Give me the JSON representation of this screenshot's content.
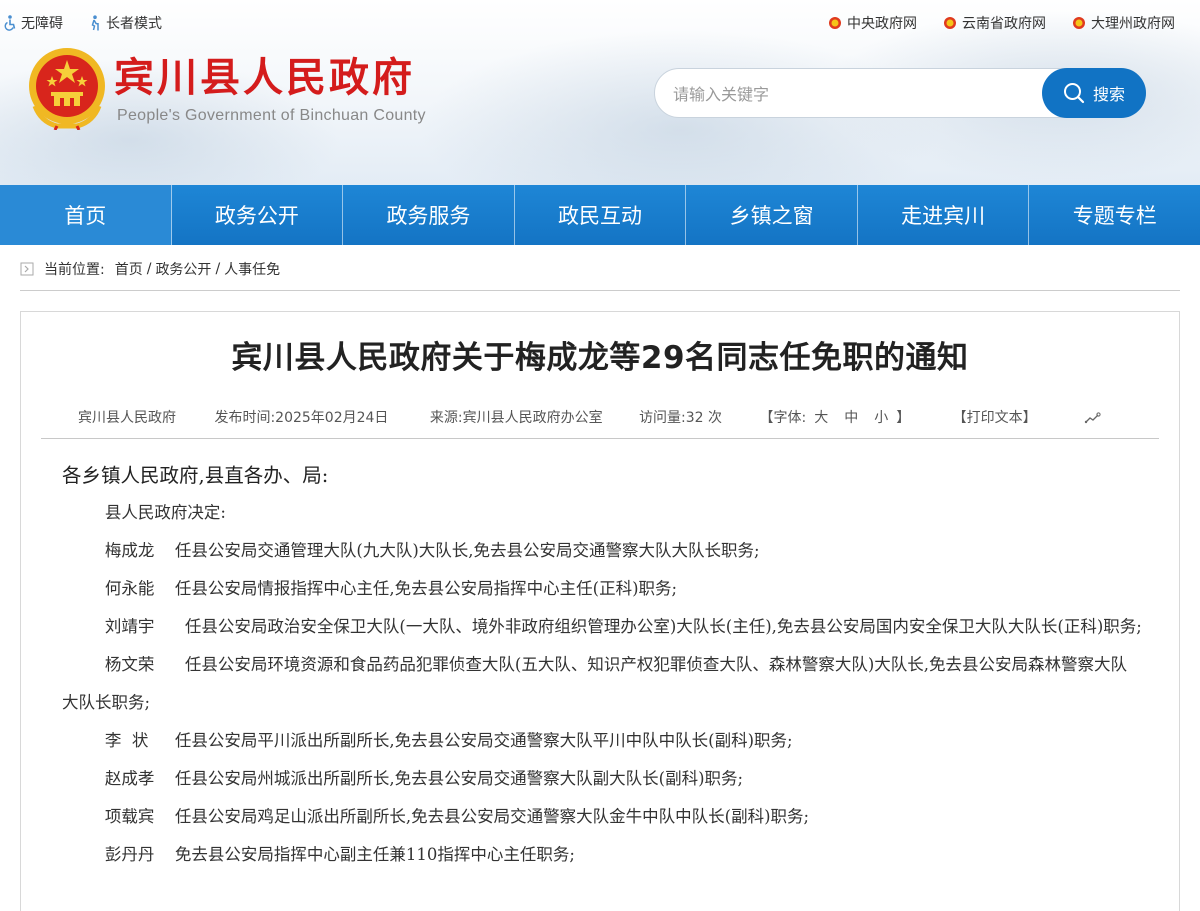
{
  "topbar": {
    "accessibility": "无障碍",
    "elder_mode": "长者模式",
    "links": [
      "中央政府网",
      "云南省政府网",
      "大理州政府网"
    ]
  },
  "site": {
    "title": "宾川县人民政府",
    "subtitle": "People's Government of Binchuan County"
  },
  "search": {
    "placeholder": "请输入关键字",
    "button_label": "搜索"
  },
  "nav": [
    "首页",
    "政务公开",
    "政务服务",
    "政民互动",
    "乡镇之窗",
    "走进宾川",
    "专题专栏"
  ],
  "breadcrumb": {
    "label": "当前位置:",
    "items": [
      "首页",
      "政务公开",
      "人事任免"
    ],
    "separator": "/"
  },
  "article": {
    "title": "宾川县人民政府关于梅成龙等29名同志任免职的通知",
    "meta": {
      "org": "宾川县人民政府",
      "publish_time": "发布时间:2025年02月24日",
      "source": "来源:宾川县人民政府办公室",
      "visits": "访问量:32 次",
      "font_label": "【字体:",
      "font_sizes": [
        "大",
        "中",
        "小"
      ],
      "font_close": "】",
      "print": "【打印文本】"
    },
    "salutation": "各乡镇人民政府,县直各办、局:",
    "decision": "县人民政府决定:",
    "entries": [
      {
        "name": "梅成龙",
        "text": "任县公安局交通管理大队(九大队)大队长,免去县公安局交通警察大队大队长职务;"
      },
      {
        "name": "何永能",
        "text": "任县公安局情报指挥中心主任,免去县公安局指挥中心主任(正科)职务;"
      },
      {
        "name": "刘靖宇",
        "text": "任县公安局政治安全保卫大队(一大队、境外非政府组织管理办公室)大队长(主任),免去县公安局国内安全保卫大队大队长(正科)职务;"
      },
      {
        "name": "杨文荣",
        "text": "任县公安局环境资源和食品药品犯罪侦查大队(五大队、知识产权犯罪侦查大队、森林警察大队)大队长,免去县公安局森林警察大队大队长职务;"
      },
      {
        "name": "李  状",
        "text": "任县公安局平川派出所副所长,免去县公安局交通警察大队平川中队中队长(副科)职务;"
      },
      {
        "name": "赵成孝",
        "text": "任县公安局州城派出所副所长,免去县公安局交通警察大队副大队长(副科)职务;"
      },
      {
        "name": "项载宾",
        "text": "任县公安局鸡足山派出所副所长,免去县公安局交通警察大队金牛中队中队长(副科)职务;"
      },
      {
        "name": "彭丹丹",
        "text": "免去县公安局指挥中心副主任兼110指挥中心主任职务;"
      }
    ]
  },
  "colors": {
    "title_red": "#d41c1c",
    "nav_blue": "#1474c4",
    "search_blue": "#1173c4"
  }
}
